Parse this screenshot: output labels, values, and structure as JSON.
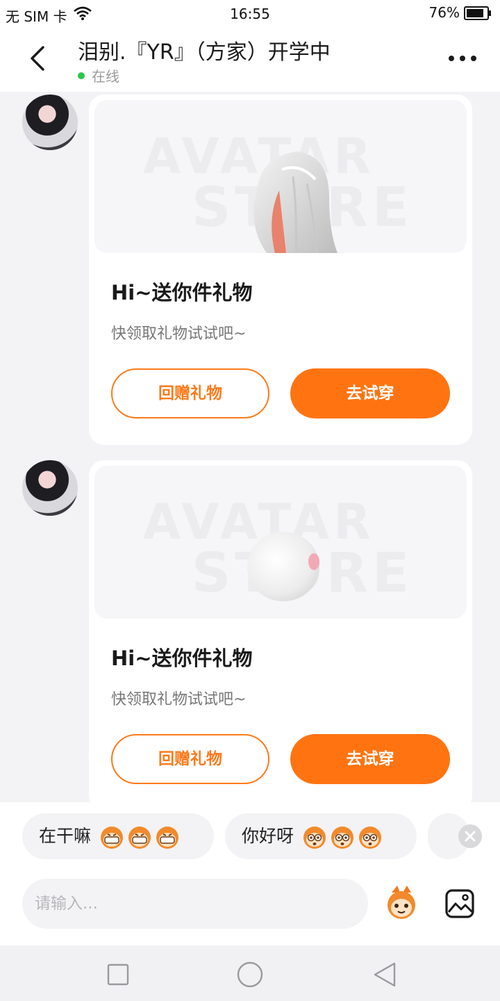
{
  "status_bar": {
    "carrier": "无 SIM 卡",
    "time": "16:55",
    "battery": "76%"
  },
  "header": {
    "title": "泪别.『YR』（方家）开学中",
    "status": "在线"
  },
  "messages": [
    {
      "title": "Hi~送你件礼物",
      "subtitle": "快领取礼物试试吧~",
      "return_gift_label": "回赠礼物",
      "try_on_label": "去试穿",
      "watermark_top": "AVATAR",
      "watermark_bottom": "STORE"
    },
    {
      "title": "Hi~送你件礼物",
      "subtitle": "快领取礼物试试吧~",
      "return_gift_label": "回赠礼物",
      "try_on_label": "去试穿",
      "watermark_top": "AVATAR",
      "watermark_bottom": "STORE"
    }
  ],
  "quick_replies": [
    {
      "text": "在干嘛",
      "emoji": "grinning-mascot-icon"
    },
    {
      "text": "你好呀",
      "emoji": "wide-eyed-mascot-icon"
    }
  ],
  "input": {
    "placeholder": "请输入..."
  },
  "colors": {
    "accent": "#ff7411",
    "online": "#2bc84a"
  }
}
